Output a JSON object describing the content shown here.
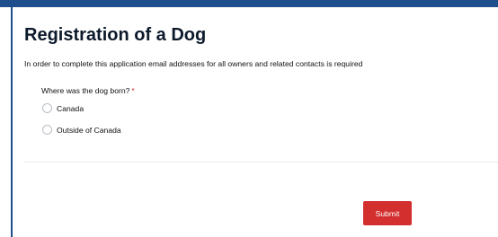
{
  "form": {
    "title": "Registration of a Dog",
    "intro": "In order to complete this application email addresses for all owners and related contacts is required",
    "question": {
      "label": "Where was the dog born?",
      "required_marker": "*",
      "options": [
        {
          "label": "Canada",
          "selected": false
        },
        {
          "label": "Outside of Canada",
          "selected": false
        }
      ]
    },
    "submit_label": "Submit"
  },
  "colors": {
    "frame_border": "#1f4e8c",
    "required": "#c62828",
    "submit_background": "#d32f2f"
  }
}
